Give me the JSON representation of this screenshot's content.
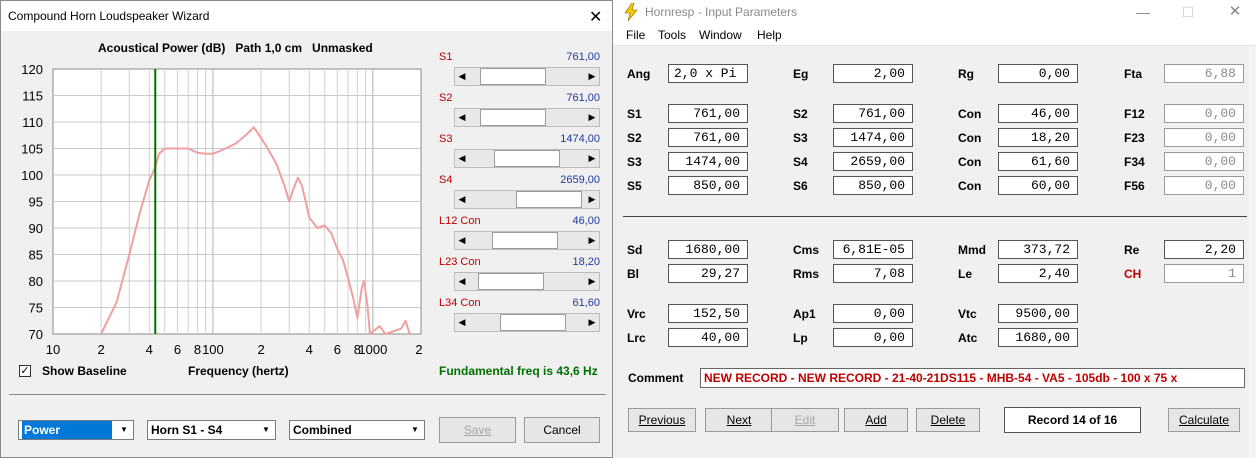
{
  "hornresp": {
    "title": "Hornresp - Input Parameters",
    "menu": [
      "File",
      "Tools",
      "Window",
      "Help"
    ],
    "params": {
      "ang": {
        "label": "Ang",
        "value": "2,0 x Pi"
      },
      "eg": {
        "label": "Eg",
        "value": "2,00"
      },
      "rg": {
        "label": "Rg",
        "value": "0,00"
      },
      "fta": {
        "label": "Fta",
        "value": "6,88"
      },
      "s1": {
        "label": "S1",
        "value": "761,00"
      },
      "s2": {
        "label": "S2",
        "value": "761,00"
      },
      "s3": {
        "label": "S3",
        "value": "1474,00"
      },
      "s5": {
        "label": "S5",
        "value": "850,00"
      },
      "c2_s2": {
        "label": "S2",
        "value": "761,00"
      },
      "c2_s3": {
        "label": "S3",
        "value": "1474,00"
      },
      "c2_s4": {
        "label": "S4",
        "value": "2659,00"
      },
      "c2_s6": {
        "label": "S6",
        "value": "850,00"
      },
      "con1": {
        "label": "Con",
        "value": "46,00"
      },
      "con2": {
        "label": "Con",
        "value": "18,20"
      },
      "con3": {
        "label": "Con",
        "value": "61,60"
      },
      "con4": {
        "label": "Con",
        "value": "60,00"
      },
      "f12": {
        "label": "F12",
        "value": "0,00"
      },
      "f23": {
        "label": "F23",
        "value": "0,00"
      },
      "f34": {
        "label": "F34",
        "value": "0,00"
      },
      "f56": {
        "label": "F56",
        "value": "0,00"
      },
      "sd": {
        "label": "Sd",
        "value": "1680,00"
      },
      "bl": {
        "label": "Bl",
        "value": "29,27"
      },
      "cms": {
        "label": "Cms",
        "value": "6,81E-05"
      },
      "rms": {
        "label": "Rms",
        "value": "7,08"
      },
      "mmd": {
        "label": "Mmd",
        "value": "373,72"
      },
      "le": {
        "label": "Le",
        "value": "2,40"
      },
      "re": {
        "label": "Re",
        "value": "2,20"
      },
      "ch": {
        "label": "CH",
        "value": "1"
      },
      "vrc": {
        "label": "Vrc",
        "value": "152,50"
      },
      "lrc": {
        "label": "Lrc",
        "value": "40,00"
      },
      "ap1": {
        "label": "Ap1",
        "value": "0,00"
      },
      "lp": {
        "label": "Lp",
        "value": "0,00"
      },
      "vtc": {
        "label": "Vtc",
        "value": "9500,00"
      },
      "atc": {
        "label": "Atc",
        "value": "1680,00"
      }
    },
    "comment": {
      "label": "Comment",
      "value": "NEW RECORD - NEW RECORD - 21-40-21DS115 - MHB-54 - VA5 - 105db - 100 x 75 x"
    },
    "buttons": {
      "previous": "Previous",
      "next": "Next",
      "edit": "Edit",
      "add": "Add",
      "delete": "Delete",
      "calculate": "Calculate"
    },
    "record": "Record 14 of 16"
  },
  "wizard": {
    "title": "Compound Horn Loudspeaker Wizard",
    "chart_title": "Acoustical Power (dB)   Path 1,0 cm   Unmasked",
    "sliders": [
      {
        "label": "S1",
        "value": "761,00",
        "position": 0.22
      },
      {
        "label": "S2",
        "value": "761,00",
        "position": 0.22
      },
      {
        "label": "S3",
        "value": "1474,00",
        "position": 0.5
      },
      {
        "label": "S4",
        "value": "2659,00",
        "position": 0.94
      },
      {
        "label": "L12  Con",
        "value": "46,00",
        "position": 0.46
      },
      {
        "label": "L23  Con",
        "value": "18,20",
        "position": 0.18
      },
      {
        "label": "L34  Con",
        "value": "61,60",
        "position": 0.62
      }
    ],
    "show_baseline": {
      "label": "Show Baseline",
      "checked": true,
      "check_glyph": "✓"
    },
    "freq_label": "Frequency (hertz)",
    "fundamental": "Fundamental freq is 43,6 Hz",
    "combos": {
      "mode": "Power",
      "horn": "Horn S1 - S4",
      "combine": "Combined"
    },
    "buttons": {
      "save": "Save",
      "cancel": "Cancel"
    }
  },
  "chart_data": {
    "type": "line",
    "title": "Acoustical Power (dB)   Path 1,0 cm   Unmasked",
    "xlabel": "Frequency (hertz)",
    "ylabel": "",
    "x_scale": "log",
    "xlim": [
      10,
      2000
    ],
    "ylim": [
      70,
      120
    ],
    "x_tick_labels": [
      "10",
      "2",
      "4",
      "6",
      "8",
      "100",
      "2",
      "4",
      "6",
      "8",
      "1000",
      "2"
    ],
    "y_ticks": [
      70,
      75,
      80,
      85,
      90,
      95,
      100,
      105,
      110,
      115,
      120
    ],
    "grid": true,
    "marker_line": {
      "x": 43.6,
      "color": "#007000"
    },
    "series": [
      {
        "color": "#f0a0a0",
        "points": [
          [
            20,
            70
          ],
          [
            25,
            76
          ],
          [
            30,
            85
          ],
          [
            35,
            93
          ],
          [
            40,
            99
          ],
          [
            43.6,
            101.5
          ],
          [
            46,
            104
          ],
          [
            50,
            105
          ],
          [
            60,
            105
          ],
          [
            70,
            105
          ],
          [
            80,
            104.2
          ],
          [
            90,
            104
          ],
          [
            100,
            104
          ],
          [
            120,
            105
          ],
          [
            140,
            106
          ],
          [
            160,
            107.5
          ],
          [
            180,
            109
          ],
          [
            200,
            107
          ],
          [
            220,
            105
          ],
          [
            250,
            102
          ],
          [
            280,
            98
          ],
          [
            300,
            95
          ],
          [
            320,
            97.5
          ],
          [
            340,
            99.5
          ],
          [
            360,
            98
          ],
          [
            380,
            95
          ],
          [
            400,
            92
          ],
          [
            450,
            90
          ],
          [
            500,
            90.5
          ],
          [
            550,
            89
          ],
          [
            600,
            86
          ],
          [
            650,
            84
          ],
          [
            700,
            80.5
          ],
          [
            750,
            77
          ],
          [
            800,
            73
          ],
          [
            850,
            78.5
          ],
          [
            880,
            80
          ],
          [
            920,
            76
          ],
          [
            960,
            70
          ],
          [
            1100,
            71.5
          ],
          [
            1200,
            70
          ],
          [
            1500,
            71
          ],
          [
            1600,
            72.5
          ],
          [
            1700,
            70
          ]
        ]
      }
    ]
  }
}
